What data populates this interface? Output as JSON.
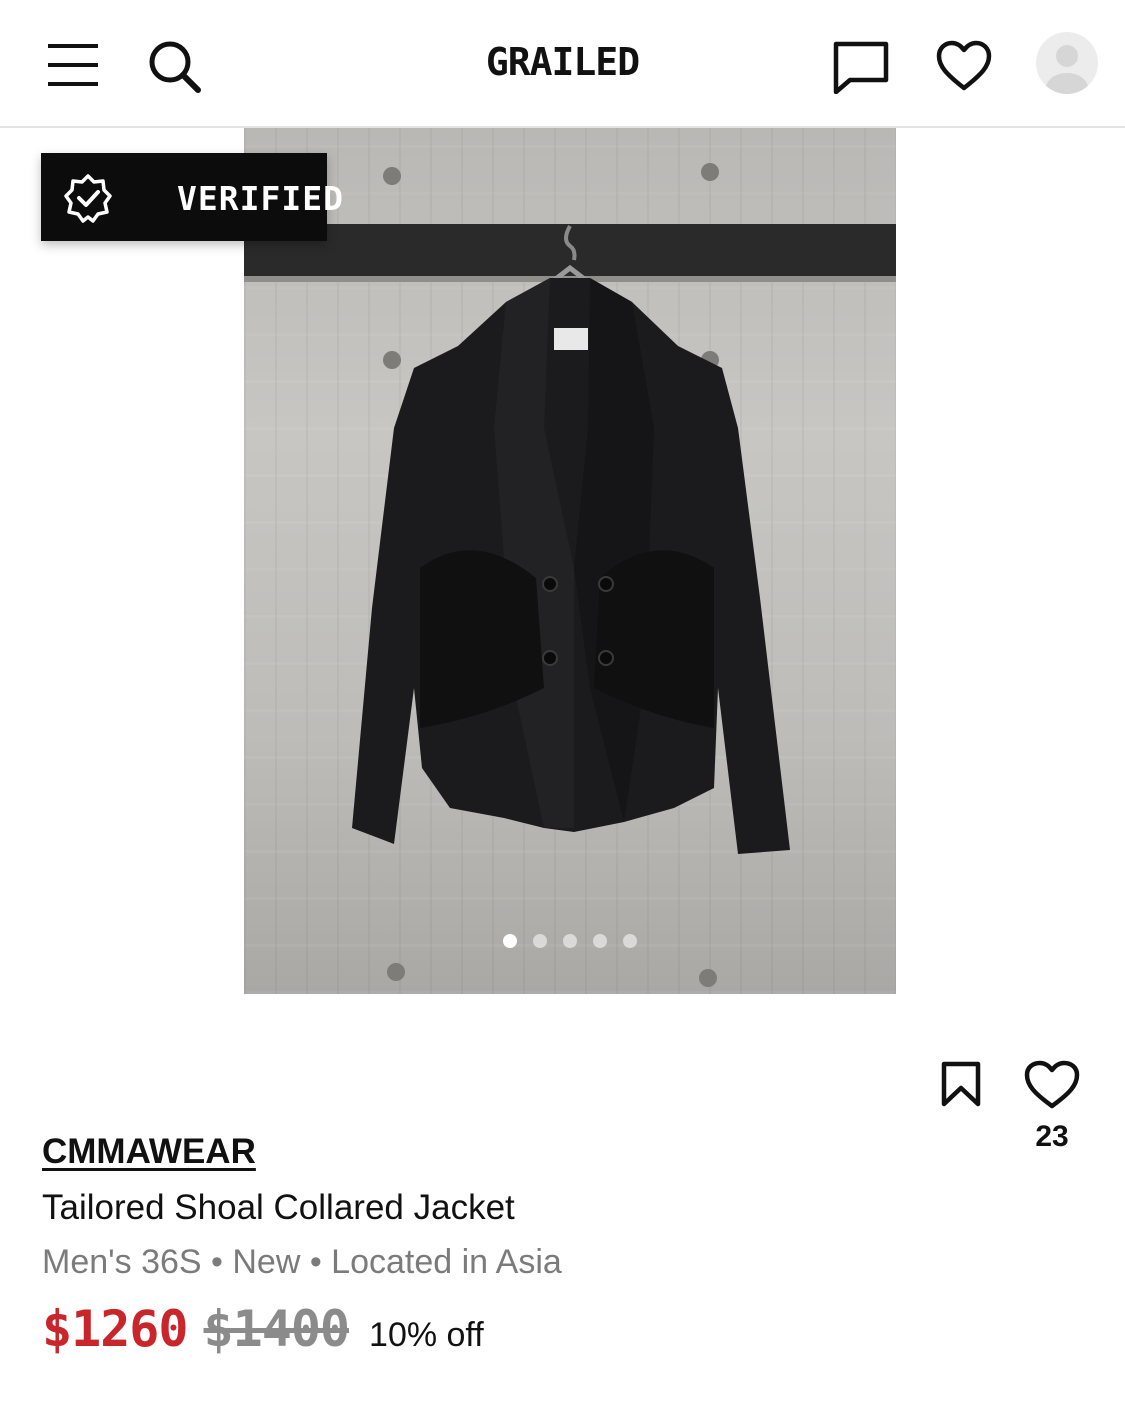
{
  "header": {
    "logo": "GRAILED",
    "icons": [
      "menu-icon",
      "search-icon",
      "chat-icon",
      "heart-icon",
      "avatar"
    ]
  },
  "badge": {
    "label": "VERIFIED",
    "icon": "verified-check-icon"
  },
  "gallery": {
    "image_count": 5,
    "current_index": 1
  },
  "listing": {
    "brand": "CMMAWEAR",
    "title": "Tailored Shoal Collared Jacket",
    "meta": "Men's 36S • New • Located in Asia",
    "price": "$1260",
    "original_price": "$1400",
    "discount": "10% off",
    "like_count": "23"
  },
  "colors": {
    "price": "#c8262b",
    "badge_bg": "#0c0c0c",
    "muted_text": "#7b7b7b"
  }
}
